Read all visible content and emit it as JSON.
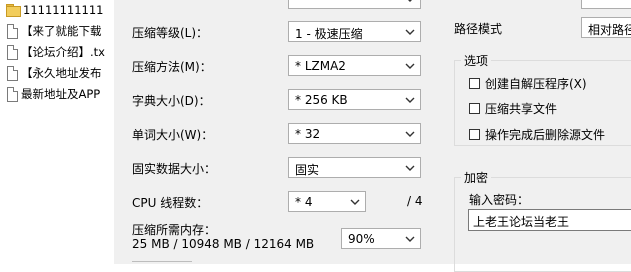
{
  "file_list": {
    "folder": "11111111111",
    "files": [
      "【来了就能下载",
      "【论坛介绍】.tx",
      "【永久地址发布",
      "最新地址及APP"
    ]
  },
  "left": {
    "compression_level": {
      "label": "压缩等级(L)：",
      "value": "1 - 极速压缩"
    },
    "compression_method": {
      "label": "压缩方法(M)：",
      "value": "* LZMA2"
    },
    "dictionary_size": {
      "label": "字典大小(D)：",
      "value": "* 256 KB"
    },
    "word_size": {
      "label": "单词大小(W)：",
      "value": "* 32"
    },
    "solid_block_size": {
      "label": "固实数据大小：",
      "value": "固实"
    },
    "cpu_threads": {
      "label": "CPU 线程数：",
      "value": "* 4",
      "max": "/ 4"
    },
    "memory_usage": {
      "label": "压缩所需内存：",
      "detail": "25 MB / 10948 MB / 12164 MB",
      "value": "90%"
    }
  },
  "right": {
    "path_mode": {
      "label": "路径模式",
      "value": "相对路径"
    },
    "options": {
      "title": "选项",
      "items": [
        "创建自解压程序(X)",
        "压缩共享文件",
        "操作完成后删除源文件"
      ]
    },
    "encryption": {
      "title": "加密",
      "password_label": "输入密码：",
      "password_value": "上老王论坛当老王"
    }
  }
}
